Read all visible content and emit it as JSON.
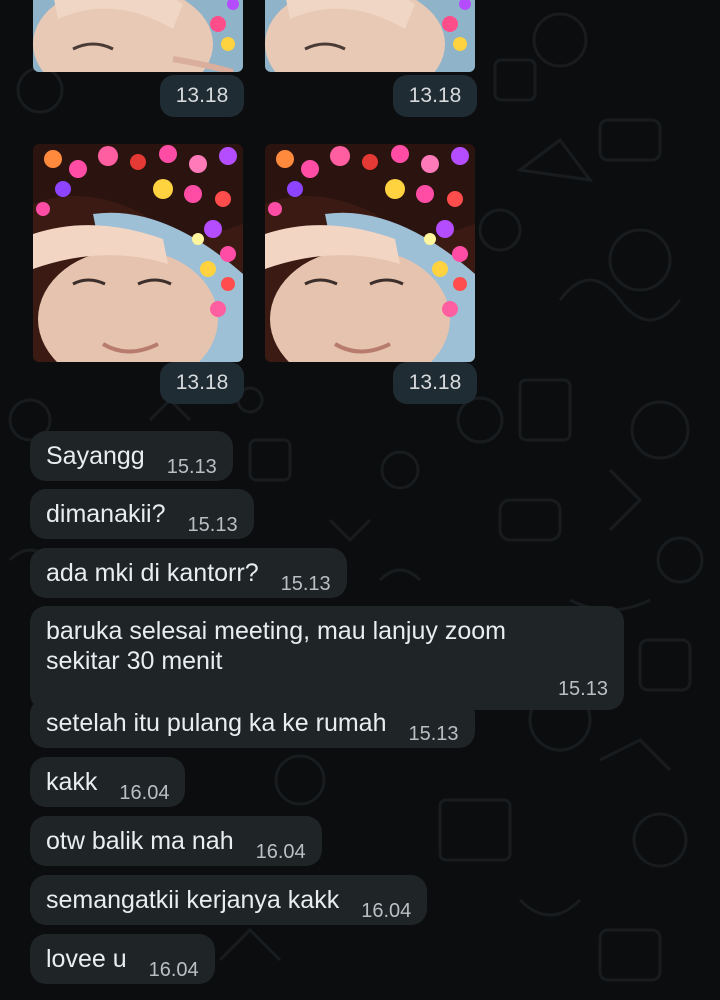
{
  "images": [
    {
      "time": "13.18"
    },
    {
      "time": "13.18"
    },
    {
      "time": "13.18"
    },
    {
      "time": "13.18"
    }
  ],
  "messages": [
    {
      "text": "Sayangg",
      "time": "15.13"
    },
    {
      "text": "dimanakii?",
      "time": "15.13"
    },
    {
      "text": "ada mki di kantorr?",
      "time": "15.13"
    },
    {
      "line1": "baruka selesai meeting, mau lanjuy zoom",
      "line2": "sekitar 30 menit",
      "time": "15.13"
    },
    {
      "text": "setelah itu pulang ka ke rumah",
      "time": "15.13"
    },
    {
      "text": "kakk",
      "time": "16.04"
    },
    {
      "text": "otw balik ma nah",
      "time": "16.04"
    },
    {
      "text": "semangatkii kerjanya kakk",
      "time": "16.04"
    },
    {
      "text": "lovee u",
      "time": "16.04"
    }
  ],
  "colors": {
    "background": "#0c0d0e",
    "bubble": "#1f2426",
    "time_chip": "#202c33",
    "text": "#e9edef"
  }
}
